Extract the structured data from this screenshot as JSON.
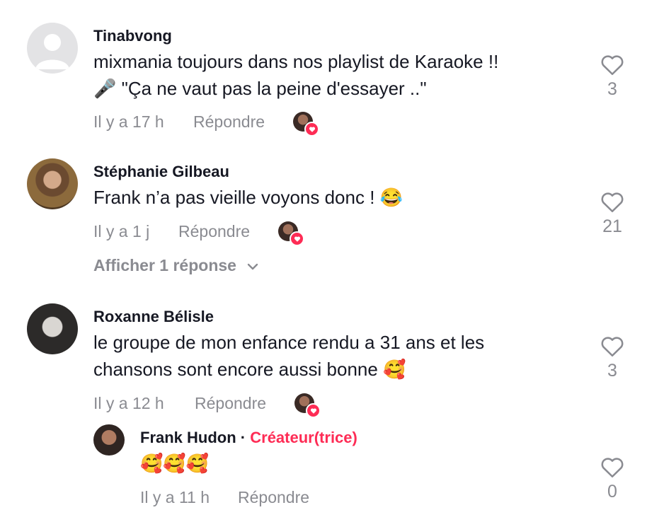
{
  "comments": [
    {
      "username": "Tinabvong",
      "text_line1": "mixmania toujours dans nos playlist de Karaoke !!",
      "text_line2": "🎤 \"Ça ne vaut pas la peine d'essayer ..\"",
      "time": "Il y a 17 h",
      "reply_label": "Répondre",
      "likes": "3"
    },
    {
      "username": "Stéphanie Gilbeau",
      "text_line1": "Frank n’a pas vieille voyons donc ! 😂",
      "time": "Il y a 1 j",
      "reply_label": "Répondre",
      "likes": "21",
      "view_replies": "Afficher 1 réponse"
    },
    {
      "username": "Roxanne Bélisle",
      "text_line1": "le groupe de mon enfance rendu a 31 ans et les",
      "text_line2": "chansons sont encore aussi bonne 🥰",
      "time": "Il y a 12 h",
      "reply_label": "Répondre",
      "likes": "3"
    }
  ],
  "reply": {
    "username": "Frank Hudon",
    "separator": "·",
    "creator_label": "Créateur(trice)",
    "text": "🥰🥰🥰",
    "time": "Il y a 11 h",
    "reply_label": "Répondre",
    "likes": "0"
  },
  "colors": {
    "accent": "#fe2c55",
    "muted": "#8a8b91",
    "text": "#161823"
  },
  "icons": {
    "like": "heart-outline-icon",
    "creator_liked": "heart-badge-icon",
    "expand": "chevron-down-icon",
    "default_avatar": "person-placeholder-icon"
  }
}
